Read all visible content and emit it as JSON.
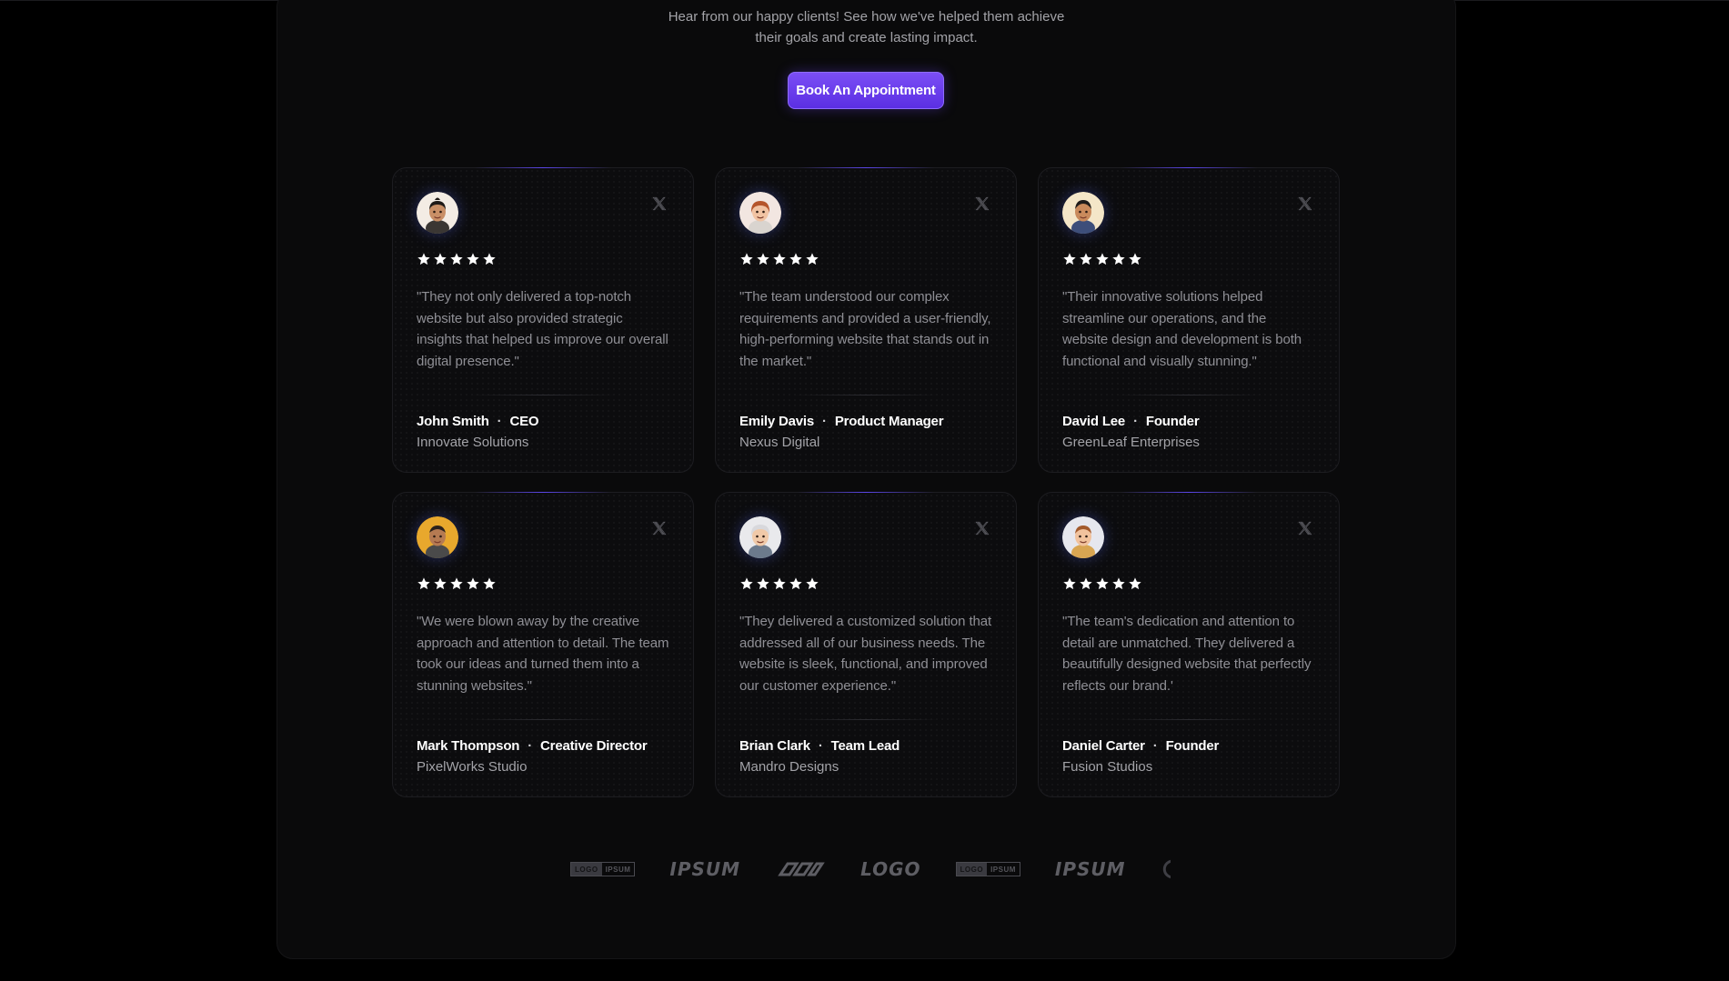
{
  "intro": {
    "line1": "Hear from our happy clients! See how we've helped them achieve",
    "line2": "their goals and create lasting impact."
  },
  "cta": {
    "label": "Book An Appointment"
  },
  "colors": {
    "accent": "#6a3cf0",
    "background": "#000000",
    "card_background": "#0c0c0e",
    "star": "#ffffff"
  },
  "testimonials": [
    {
      "avatar_icon": "memoji-avatar-icon",
      "rating": 5,
      "quote": "\"They not only delivered a top-notch website but also provided strategic insights that helped us improve our overall digital presence.\"",
      "name": "John Smith",
      "role": "CEO",
      "company": "Innovate Solutions"
    },
    {
      "avatar_icon": "memoji-avatar-icon",
      "rating": 5,
      "quote": "\"The team understood our complex requirements and provided a user-friendly, high-performing website that stands out in the market.\"",
      "name": "Emily Davis",
      "role": "Product Manager",
      "company": "Nexus Digital"
    },
    {
      "avatar_icon": "memoji-avatar-icon",
      "rating": 5,
      "quote": "\"Their innovative solutions helped streamline our operations, and the website design and development is both functional and visually stunning.\"",
      "name": "David Lee",
      "role": "Founder",
      "company": "GreenLeaf Enterprises"
    },
    {
      "avatar_icon": "memoji-avatar-icon",
      "rating": 5,
      "quote": "\"We were blown away by the creative approach and attention to detail. The team took our ideas and turned them into a stunning websites.\"",
      "name": "Mark Thompson",
      "role": "Creative Director",
      "company": "PixelWorks Studio"
    },
    {
      "avatar_icon": "memoji-avatar-icon",
      "rating": 5,
      "quote": "\"They delivered a customized solution that addressed all of our business needs. The website is sleek, functional, and improved our customer experience.\"",
      "name": "Brian Clark",
      "role": "Team Lead",
      "company": "Mandro Designs"
    },
    {
      "avatar_icon": "memoji-avatar-icon",
      "rating": 5,
      "quote": "\"The team's dedication and attention to detail are unmatched. They delivered a beautifully designed website that perfectly reflects our brand.'",
      "name": "Daniel Carter",
      "role": "Founder",
      "company": "Fusion Studios"
    }
  ],
  "logos": [
    {
      "kind": "box",
      "left": "LOGO",
      "right": "IPSUM"
    },
    {
      "kind": "text",
      "text": "IPSUM"
    },
    {
      "kind": "infinity"
    },
    {
      "kind": "text",
      "text": "LOGO"
    },
    {
      "kind": "box",
      "left": "LOGO",
      "right": "IPSUM"
    },
    {
      "kind": "text",
      "text": "IPSUM"
    },
    {
      "kind": "partial"
    }
  ]
}
